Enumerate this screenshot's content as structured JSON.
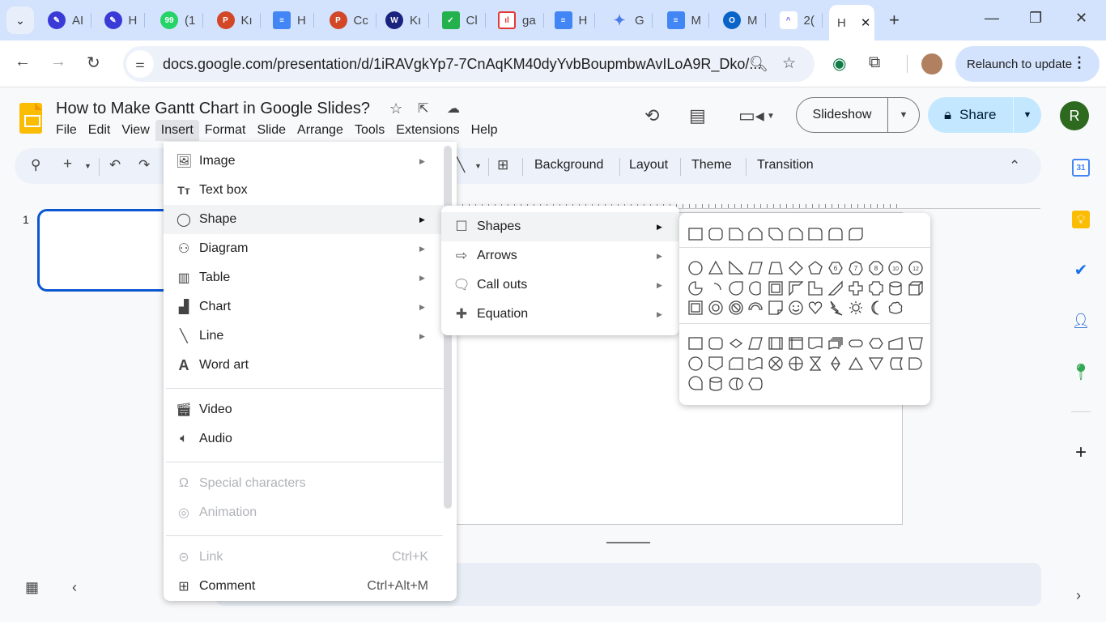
{
  "browser": {
    "tabs": [
      {
        "title": "AI",
        "icon": "feather-icon",
        "color": "#3a3ad6"
      },
      {
        "title": "H",
        "icon": "feather-icon",
        "color": "#3a3ad6"
      },
      {
        "title": "(1",
        "icon": "whatsapp-icon",
        "color": "#25d366",
        "badge": "99+"
      },
      {
        "title": "Kı",
        "icon": "powerpoint-icon",
        "color": "#d24726"
      },
      {
        "title": "H",
        "icon": "docs-icon",
        "color": "#4285f4"
      },
      {
        "title": "Cc",
        "icon": "powerpoint-icon",
        "color": "#d24726"
      },
      {
        "title": "Kı",
        "icon": "wpp-icon",
        "color": "#1a237e"
      },
      {
        "title": "Cl",
        "icon": "checkbox-icon",
        "color": "#23b14d"
      },
      {
        "title": "ga",
        "icon": "chart-app-icon",
        "color": "#e53935"
      },
      {
        "title": "H",
        "icon": "docs-icon",
        "color": "#4285f4"
      },
      {
        "title": "G",
        "icon": "gemini-icon",
        "color": "#4a7be8"
      },
      {
        "title": "M",
        "icon": "docs-icon",
        "color": "#4285f4"
      },
      {
        "title": "M",
        "icon": "outlook-icon",
        "color": "#0a64c8"
      },
      {
        "title": "2(",
        "icon": "clickup-icon",
        "color": "#7b68ee"
      },
      {
        "title": "H",
        "icon": "",
        "color": "",
        "active": true
      }
    ],
    "url": "docs.google.com/presentation/d/1iRAVgkYp7-7CnAqKM40dyYvbBoupmbwAvILoA9R_Dko/...",
    "relaunch_label": "Relaunch to update"
  },
  "app": {
    "title": "How to Make Gantt Chart in Google Slides?",
    "menu": [
      "File",
      "Edit",
      "View",
      "Insert",
      "Format",
      "Slide",
      "Arrange",
      "Tools",
      "Extensions",
      "Help"
    ],
    "open_menu": "Insert",
    "slideshow_label": "Slideshow",
    "share_label": "Share",
    "avatar_initial": "R",
    "accent_color": "#0b57d0"
  },
  "toolbar": {
    "items": [
      "Background",
      "Layout",
      "Theme",
      "Transition"
    ]
  },
  "filmstrip": {
    "slides": [
      {
        "number": "1"
      }
    ]
  },
  "insert_menu": {
    "groups": [
      [
        {
          "label": "Image",
          "icon": "image-icon",
          "submenu": true
        },
        {
          "label": "Text box",
          "icon": "text-box-icon",
          "submenu": false
        },
        {
          "label": "Shape",
          "icon": "shape-icon",
          "submenu": true,
          "highlighted": true
        },
        {
          "label": "Diagram",
          "icon": "diagram-icon",
          "submenu": true
        },
        {
          "label": "Table",
          "icon": "table-icon",
          "submenu": true
        },
        {
          "label": "Chart",
          "icon": "chart-icon",
          "submenu": true
        },
        {
          "label": "Line",
          "icon": "line-icon",
          "submenu": true
        },
        {
          "label": "Word art",
          "icon": "word-art-icon",
          "submenu": false
        }
      ],
      [
        {
          "label": "Video",
          "icon": "video-icon"
        },
        {
          "label": "Audio",
          "icon": "audio-icon"
        }
      ],
      [
        {
          "label": "Special characters",
          "icon": "omega-icon",
          "disabled": true
        },
        {
          "label": "Animation",
          "icon": "animation-icon",
          "disabled": true
        }
      ],
      [
        {
          "label": "Link",
          "icon": "link-icon",
          "disabled": true,
          "shortcut": "Ctrl+K"
        },
        {
          "label": "Comment",
          "icon": "comment-icon",
          "shortcut": "Ctrl+Alt+M"
        }
      ]
    ]
  },
  "shape_menu": {
    "items": [
      {
        "label": "Shapes",
        "icon": "square-icon",
        "highlighted": true
      },
      {
        "label": "Arrows",
        "icon": "arrow-icon"
      },
      {
        "label": "Call outs",
        "icon": "callout-icon"
      },
      {
        "label": "Equation",
        "icon": "plus-icon"
      }
    ]
  },
  "shapes_palette": {
    "sections": [
      {
        "name": "rectangles",
        "rows": [
          [
            "rectangle",
            "rounded-rectangle",
            "snip-single-corner",
            "snip-same-side",
            "snip-diagonal",
            "snip-round-single",
            "round-single-corner",
            "round-same-side",
            "round-diagonal"
          ]
        ]
      },
      {
        "name": "basic",
        "rows": [
          [
            "oval",
            "triangle",
            "right-triangle",
            "parallelogram",
            "trapezoid",
            "diamond",
            "pentagon",
            "hexagon-6",
            "heptagon-7",
            "octagon-8",
            "decagon-10",
            "dodecagon-12"
          ],
          [
            "pie",
            "arc",
            "teardrop",
            "chord",
            "frame",
            "half-frame",
            "l-shape",
            "diagonal-stripe",
            "cross",
            "plaque",
            "can",
            "cube"
          ],
          [
            "bevel",
            "donut",
            "no-symbol",
            "block-arc",
            "folded-corner",
            "smiley",
            "heart",
            "lightning",
            "sun",
            "moon",
            "cloud"
          ]
        ]
      },
      {
        "name": "flowchart",
        "rows": [
          [
            "process",
            "alternate-process",
            "decision",
            "data",
            "predefined-process",
            "internal-storage",
            "document",
            "multidocument",
            "terminator",
            "preparation",
            "manual-input",
            "manual-operation"
          ],
          [
            "connector",
            "offpage-connector",
            "card",
            "punched-tape",
            "summing-junction",
            "or",
            "collate",
            "sort",
            "extract",
            "merge",
            "stored-data",
            "delay"
          ],
          [
            "sequential-access",
            "magnetic-disk",
            "direct-access",
            "display"
          ]
        ]
      }
    ]
  }
}
